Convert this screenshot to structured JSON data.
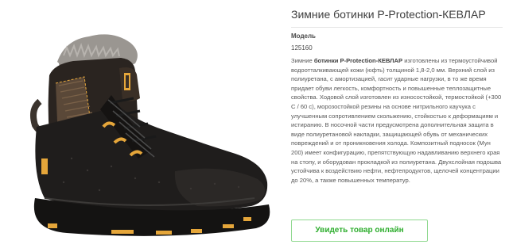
{
  "product": {
    "title": "Зимние ботинки P-Protection-КЕВЛАР",
    "model_label": "Модель",
    "model_value": "125160",
    "description": {
      "prefix": "Зимние ",
      "bold_name": "ботинки P-Protection-КЕВЛАР",
      "text": " изготовлены из термоустойчивой водоотталкивающей кожи (юфть) толщиной 1,8-2,0 мм. Верхний слой из полиуретана, с амортизацией, гасит ударные нагрузки, в то же время придает обуви легкость, комфортность и повышенные теплозащитные свойства. Ходовой слой изготовлен из износостойкой, термостойкой (+300 С / 60 с), морозостойкой резины на основе нитрильного каучука с улучшенным сопротивлением скольжению, стойкостью к деформациям и истиранию. В носочной части предусмотрена дополнительная защита в виде полиуретановой накладки, защищающей обувь от механических повреждений и от проникновения холода. Композитный подносок (Мун 200) имеет конфигурацию, препятствующую надавливанию верхнего края на стопу, и оборудован прокладкой из полиуретана. Двухслойная подошва устойчива к воздействию нефти, нефтепродуктов, щелочей концентрации до 20%, а также повышенных температур."
    },
    "cta_label": "Увидеть товар онлайн"
  },
  "image": {
    "icon": "winter-work-boot-icon",
    "leather_color": "#1f1d1c",
    "fur_color": "#8d8a86",
    "accent_color": "#e5a63a",
    "textile_color": "#5a4838"
  },
  "colors": {
    "accent_green": "#2fae2f",
    "title_text": "#3f3f3f",
    "body_text": "#585858"
  }
}
